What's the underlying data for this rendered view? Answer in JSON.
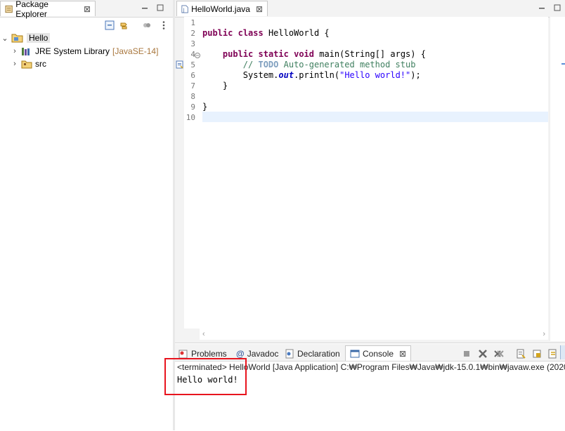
{
  "package_explorer": {
    "title": "Package Explorer",
    "close": "⊠",
    "tree": {
      "project": "Hello",
      "jre_label": "JRE System Library",
      "jre_version": "[JavaSE-14]",
      "src": "src"
    }
  },
  "editor": {
    "tab_label": "HelloWorld.java",
    "tab_close": "⊠",
    "line_numbers": [
      "1",
      "2",
      "3",
      "4",
      "5",
      "6",
      "7",
      "8",
      "9",
      "10"
    ],
    "code": {
      "l2_kw1": "public",
      "l2_kw2": "class",
      "l2_rest": " HelloWorld {",
      "l4_kw1": "public",
      "l4_kw2": "static",
      "l4_kw3": "void",
      "l4_rest": " main(String[] args) {",
      "l5_slashes": "// ",
      "l5_todo": "TODO",
      "l5_rest": " Auto-generated method stub",
      "l6_a": "System.",
      "l6_out": "out",
      "l6_b": ".println(",
      "l6_str": "\"Hello world!\"",
      "l6_c": ");",
      "l7": "}",
      "l9": "}"
    }
  },
  "bottom_tabs": {
    "problems": "Problems",
    "javadoc": "Javadoc",
    "declaration": "Declaration",
    "console": "Console",
    "console_close": "⊠"
  },
  "console": {
    "terminated_line": "<terminated> HelloWorld [Java Application] C:₩Program Files₩Java₩jdk-15.0.1₩bin₩javaw.exe  (2020",
    "output": "Hello world!",
    "highlight_color": "#e8141e"
  }
}
